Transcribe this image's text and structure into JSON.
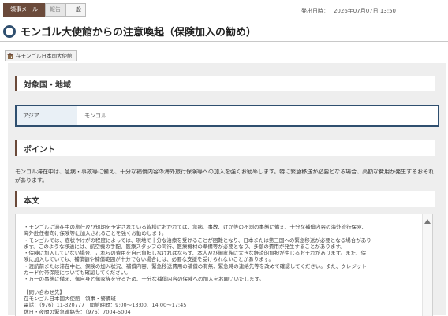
{
  "header": {
    "tabs": [
      "領事メール",
      "報告",
      "一般"
    ],
    "issued_label": "発出日時：",
    "issued_value": "2026年07月07日 13:50"
  },
  "page": {
    "title": "モンゴル大使館からの注意喚起（保険加入の勧め）",
    "embassy_label": "在モンゴル日本国大使館"
  },
  "sections": {
    "region_heading": "対象国・地域",
    "region_name": "アジア",
    "country_name": "モンゴル",
    "point_heading": "ポイント",
    "point_text": "モンゴル滞在中は、急病・事故等に備え、十分な補償内容の海外旅行保険等への加入を強くお勧めします。特に緊急移送が必要となる場合、高額な費用が発生するおそれがあります。",
    "body_heading": "本文"
  },
  "body_lines": [
    "・モンゴルに滞在中の旅行及び短期を予定されている皆様におかれては、急病、事故、けが等の不測の事態に備え、十分な補償内容の海外旅行保険、",
    "海外赴任者向け保険等に加入されることを強くお勧めします。",
    "・モンゴルでは、症状やけがの程度によっては、現地で十分な治療を受けることが困難となり、日本または第三国への緊急移送が必要となる場合があり",
    "ます。このような移送には、航空機の手配、医療スタッフの同行、医療機材の準備等が必要となり、多額の費用が発生することがあります。",
    "・保険に加入していない場合、これらの費用を自己負担しなければならず、本人及び御家族に大きな経済的負担が生じるおそれがあります。また、保",
    "険に加入していても、補償額や補償範囲が十分でない場合には、必要な支援を受けられないことがあります。",
    "・渡航前または滞在中に、保険の加入状況、補償内容、緊急移送費用の補償の有無、緊急時の連絡先等を改めて確認してください。また、クレジット",
    "カード付帯保険についても確認してください。",
    "・万一の事態に備え、御自身と御家族を守るため、十分な補償内容の保険への加入をお願いいたします。"
  ],
  "contact_lines": [
    "【問い合わせ先】",
    "在モンゴル日本国大使館　領事・警備班",
    "電話：（976）11-320777　開館時間：9:00～13:00、14:00～17:45",
    "休日・夜間の緊急連絡先：（976）7004-5004"
  ]
}
